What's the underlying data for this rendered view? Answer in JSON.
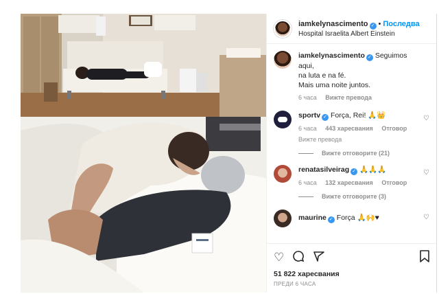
{
  "post": {
    "author": "iamkelynascimento",
    "follow_label": "Последва",
    "location": "Hospital Israelita Albert Einstein",
    "caption_user": "iamkelynascimento",
    "caption_line1": "Seguimos aqui,",
    "caption_line2": "na luta e na fé.",
    "caption_line3": "Mais uma noite juntos.",
    "caption_time": "6 часа",
    "caption_translate": "Вижте превода"
  },
  "comments": [
    {
      "user": "sportv",
      "text": "Força, Rei! 🙏👑",
      "time": "6 часа",
      "likes": "443 харесвания",
      "reply": "Отговор",
      "translate": "Вижте превода",
      "view_replies": "Вижте отговорите (21)",
      "avatar_color": "#1f1f3d"
    },
    {
      "user": "renatasilveirag",
      "text": "🙏🙏🙏",
      "time": "6 часа",
      "likes": "132 харесвания",
      "reply": "Отговор",
      "view_replies": "Вижте отговорите (3)",
      "avatar_color": "#b24a3a"
    },
    {
      "user": "maurine",
      "text": "Força 🙏🙌♥",
      "avatar_color": "#3a2a24"
    }
  ],
  "actions": {
    "like_icon": "heart-icon",
    "comment_icon": "comment-icon",
    "share_icon": "share-icon",
    "save_icon": "bookmark-icon"
  },
  "likes_count": "51 822 харесвания",
  "posted_time": "ПРЕДИ 6 ЧАСА",
  "colors": {
    "link": "#0095f6",
    "verified": "#3897f0",
    "muted": "#8e8e8e",
    "text": "#262626"
  }
}
